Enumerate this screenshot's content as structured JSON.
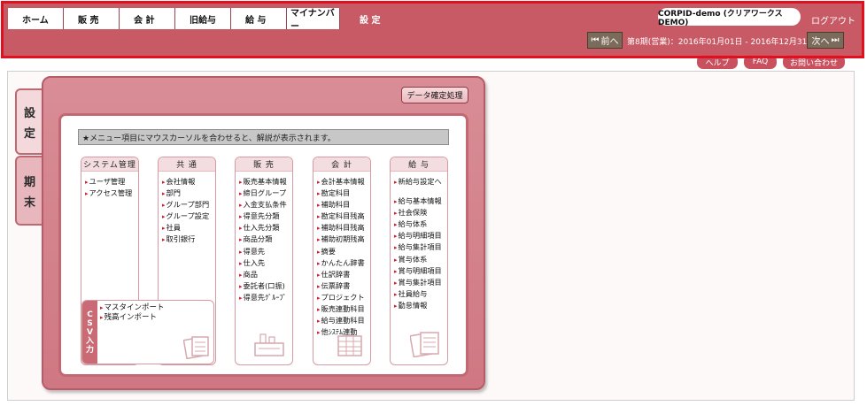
{
  "nav": {
    "items": [
      "ホーム",
      "販 売",
      "会 計",
      "旧給与",
      "給 与",
      "マイナンバー"
    ],
    "active": "設 定"
  },
  "user": {
    "company": "CORPID-demo (クリアワークスDEMO)",
    "logout": "ログアウト"
  },
  "period": {
    "prev": "前へ",
    "next": "次へ",
    "text": "第8期(営業)：2016年01月01日 - 2016年12月31日"
  },
  "links": {
    "help": "ヘルプ",
    "faq": "FAQ",
    "contact": "お問い合わせ"
  },
  "tabs": {
    "settings": [
      "設",
      "定"
    ],
    "period_end": [
      "期",
      "末"
    ]
  },
  "panel": {
    "confirm_button": "データ確定処理",
    "hint": "★メニュー項目にマウスカーソルを合わせると、解説が表示されます。"
  },
  "sections": {
    "system": {
      "title": "システム管理",
      "items": [
        "ユーザ管理",
        "アクセス管理"
      ]
    },
    "common": {
      "title": "共 通",
      "items": [
        "会社情報",
        "部門",
        "グループ部門",
        "グループ設定",
        "社員",
        "取引銀行"
      ]
    },
    "sales": {
      "title": "販 売",
      "items": [
        "販売基本情報",
        "締日グループ",
        "入金支払条件",
        "得意先分類",
        "仕入先分類",
        "商品分類",
        "得意先",
        "仕入先",
        "商品",
        "委託者(口振)",
        "得意先ｸﾞﾙｰﾌﾟ"
      ]
    },
    "accounting": {
      "title": "会 計",
      "items": [
        "会計基本情報",
        "勘定科目",
        "補助科目",
        "勘定科目残高",
        "補助科目残高",
        "補助初期残高",
        "摘要",
        "かんたん辞書",
        "仕訳辞書",
        "伝票辞書",
        "プロジェクト",
        "販売連動科目",
        "給与連動科目",
        "他ｼｽﾃﾑ連動"
      ]
    },
    "payroll": {
      "title": "給 与",
      "first_item": "新給与設定へ",
      "items": [
        "給与基本情報",
        "社会保険",
        "給与体系",
        "給与明細項目",
        "給与集計項目",
        "賞与体系",
        "賞与明細項目",
        "賞与集計項目",
        "社員給与",
        "勤怠情報"
      ]
    }
  },
  "csv": {
    "side_label": [
      "C",
      "S",
      "V",
      "入",
      "力"
    ],
    "items": [
      "マスタインポート",
      "残高インポート"
    ]
  },
  "icons": {
    "system": "computer-icon",
    "common": "network-icon",
    "sales": "cash-register-icon",
    "accounting": "ledger-icon",
    "payroll": "documents-icon",
    "csv": "documents-icon"
  },
  "colors": {
    "header": "#c85a66",
    "panel": "#cf7883",
    "accent_red": "#e0101e",
    "bullet": "#d01c2c"
  }
}
